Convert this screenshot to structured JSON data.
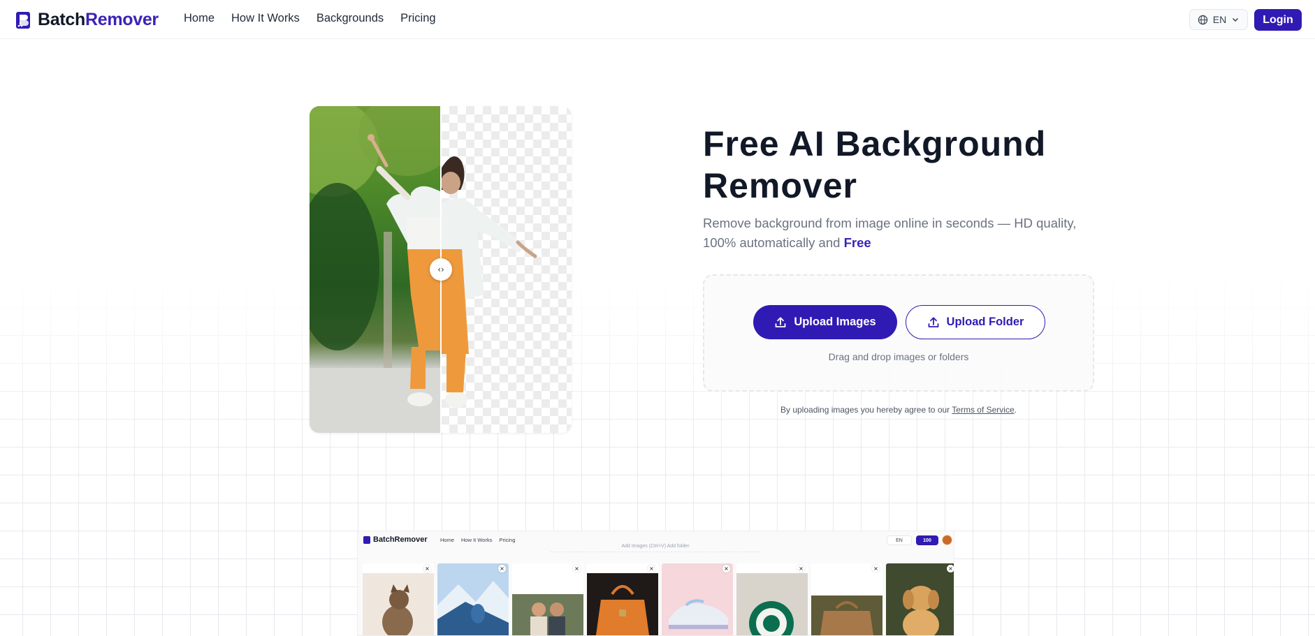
{
  "header": {
    "logo_part1": "Batch",
    "logo_part2": "Remover",
    "nav": [
      "Home",
      "How It Works",
      "Backgrounds",
      "Pricing"
    ],
    "language": "EN",
    "login_label": "Login"
  },
  "hero": {
    "title": "Free AI Background Remover",
    "subtitle_main": "Remove background from image online in seconds — HD quality, 100% automatically and ",
    "subtitle_highlight": "Free",
    "upload_images_label": "Upload Images",
    "upload_folder_label": "Upload Folder",
    "drag_text": "Drag and drop images or folders",
    "terms_prefix": "By uploading images you hereby agree to our ",
    "terms_link": "Terms of Service",
    "terms_suffix": ".",
    "handle_glyph": "‹›"
  },
  "preview": {
    "logo": "BatchRemover",
    "nav": [
      "Home",
      "How It Works",
      "Pricing"
    ],
    "language": "EN",
    "credits": "100",
    "ghost_text": "Add Images (Ctrl+V)   Add folder",
    "thumbs": [
      {
        "name": "cat",
        "close": "×"
      },
      {
        "name": "skier",
        "close": "×"
      },
      {
        "name": "couple",
        "close": "×"
      },
      {
        "name": "orange-bag",
        "close": "×"
      },
      {
        "name": "sneaker",
        "close": "×"
      },
      {
        "name": "starbucks-logo",
        "close": "×"
      },
      {
        "name": "leather-bag",
        "close": "×"
      },
      {
        "name": "puppy",
        "close": "×"
      }
    ]
  },
  "colors": {
    "brand": "#2f1bb3",
    "brand_text": "#3b22b8",
    "title": "#111827",
    "muted": "#6b7280"
  }
}
